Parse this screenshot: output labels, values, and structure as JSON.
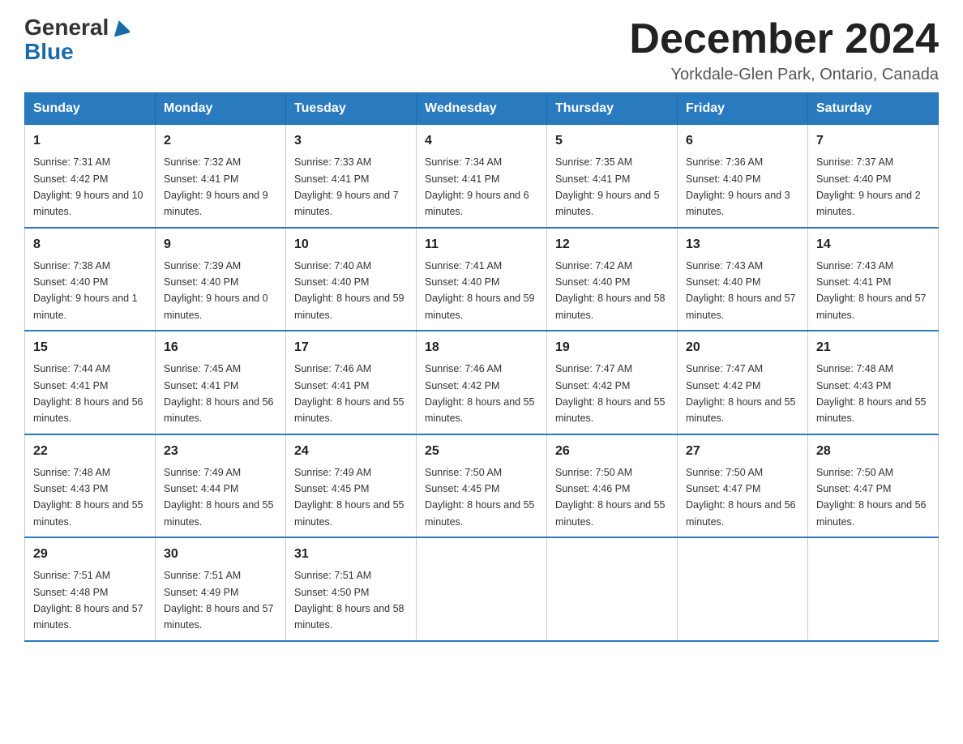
{
  "header": {
    "logo_line1": "General",
    "logo_line2": "Blue",
    "month_title": "December 2024",
    "location": "Yorkdale-Glen Park, Ontario, Canada"
  },
  "days_of_week": [
    "Sunday",
    "Monday",
    "Tuesday",
    "Wednesday",
    "Thursday",
    "Friday",
    "Saturday"
  ],
  "weeks": [
    [
      {
        "day": "1",
        "sunrise": "7:31 AM",
        "sunset": "4:42 PM",
        "daylight": "9 hours and 10 minutes."
      },
      {
        "day": "2",
        "sunrise": "7:32 AM",
        "sunset": "4:41 PM",
        "daylight": "9 hours and 9 minutes."
      },
      {
        "day": "3",
        "sunrise": "7:33 AM",
        "sunset": "4:41 PM",
        "daylight": "9 hours and 7 minutes."
      },
      {
        "day": "4",
        "sunrise": "7:34 AM",
        "sunset": "4:41 PM",
        "daylight": "9 hours and 6 minutes."
      },
      {
        "day": "5",
        "sunrise": "7:35 AM",
        "sunset": "4:41 PM",
        "daylight": "9 hours and 5 minutes."
      },
      {
        "day": "6",
        "sunrise": "7:36 AM",
        "sunset": "4:40 PM",
        "daylight": "9 hours and 3 minutes."
      },
      {
        "day": "7",
        "sunrise": "7:37 AM",
        "sunset": "4:40 PM",
        "daylight": "9 hours and 2 minutes."
      }
    ],
    [
      {
        "day": "8",
        "sunrise": "7:38 AM",
        "sunset": "4:40 PM",
        "daylight": "9 hours and 1 minute."
      },
      {
        "day": "9",
        "sunrise": "7:39 AM",
        "sunset": "4:40 PM",
        "daylight": "9 hours and 0 minutes."
      },
      {
        "day": "10",
        "sunrise": "7:40 AM",
        "sunset": "4:40 PM",
        "daylight": "8 hours and 59 minutes."
      },
      {
        "day": "11",
        "sunrise": "7:41 AM",
        "sunset": "4:40 PM",
        "daylight": "8 hours and 59 minutes."
      },
      {
        "day": "12",
        "sunrise": "7:42 AM",
        "sunset": "4:40 PM",
        "daylight": "8 hours and 58 minutes."
      },
      {
        "day": "13",
        "sunrise": "7:43 AM",
        "sunset": "4:40 PM",
        "daylight": "8 hours and 57 minutes."
      },
      {
        "day": "14",
        "sunrise": "7:43 AM",
        "sunset": "4:41 PM",
        "daylight": "8 hours and 57 minutes."
      }
    ],
    [
      {
        "day": "15",
        "sunrise": "7:44 AM",
        "sunset": "4:41 PM",
        "daylight": "8 hours and 56 minutes."
      },
      {
        "day": "16",
        "sunrise": "7:45 AM",
        "sunset": "4:41 PM",
        "daylight": "8 hours and 56 minutes."
      },
      {
        "day": "17",
        "sunrise": "7:46 AM",
        "sunset": "4:41 PM",
        "daylight": "8 hours and 55 minutes."
      },
      {
        "day": "18",
        "sunrise": "7:46 AM",
        "sunset": "4:42 PM",
        "daylight": "8 hours and 55 minutes."
      },
      {
        "day": "19",
        "sunrise": "7:47 AM",
        "sunset": "4:42 PM",
        "daylight": "8 hours and 55 minutes."
      },
      {
        "day": "20",
        "sunrise": "7:47 AM",
        "sunset": "4:42 PM",
        "daylight": "8 hours and 55 minutes."
      },
      {
        "day": "21",
        "sunrise": "7:48 AM",
        "sunset": "4:43 PM",
        "daylight": "8 hours and 55 minutes."
      }
    ],
    [
      {
        "day": "22",
        "sunrise": "7:48 AM",
        "sunset": "4:43 PM",
        "daylight": "8 hours and 55 minutes."
      },
      {
        "day": "23",
        "sunrise": "7:49 AM",
        "sunset": "4:44 PM",
        "daylight": "8 hours and 55 minutes."
      },
      {
        "day": "24",
        "sunrise": "7:49 AM",
        "sunset": "4:45 PM",
        "daylight": "8 hours and 55 minutes."
      },
      {
        "day": "25",
        "sunrise": "7:50 AM",
        "sunset": "4:45 PM",
        "daylight": "8 hours and 55 minutes."
      },
      {
        "day": "26",
        "sunrise": "7:50 AM",
        "sunset": "4:46 PM",
        "daylight": "8 hours and 55 minutes."
      },
      {
        "day": "27",
        "sunrise": "7:50 AM",
        "sunset": "4:47 PM",
        "daylight": "8 hours and 56 minutes."
      },
      {
        "day": "28",
        "sunrise": "7:50 AM",
        "sunset": "4:47 PM",
        "daylight": "8 hours and 56 minutes."
      }
    ],
    [
      {
        "day": "29",
        "sunrise": "7:51 AM",
        "sunset": "4:48 PM",
        "daylight": "8 hours and 57 minutes."
      },
      {
        "day": "30",
        "sunrise": "7:51 AM",
        "sunset": "4:49 PM",
        "daylight": "8 hours and 57 minutes."
      },
      {
        "day": "31",
        "sunrise": "7:51 AM",
        "sunset": "4:50 PM",
        "daylight": "8 hours and 58 minutes."
      },
      null,
      null,
      null,
      null
    ]
  ]
}
